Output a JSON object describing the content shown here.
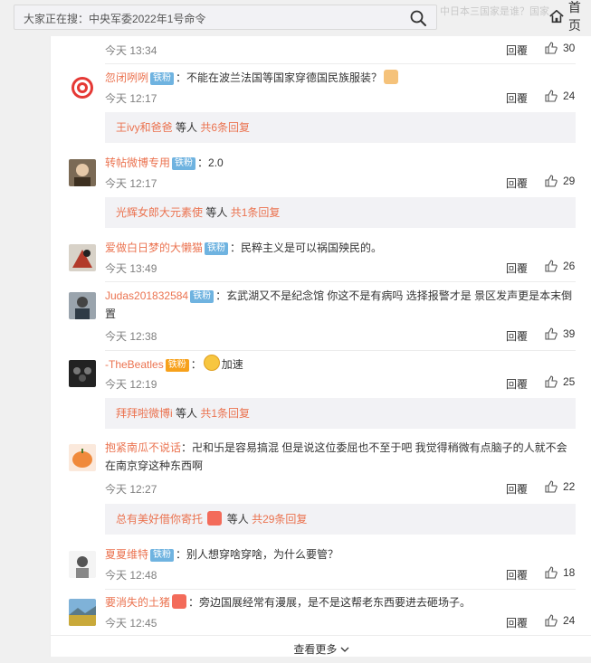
{
  "search": {
    "placeholder": "大家正在搜：中央军委2022年1号命令"
  },
  "home_label": "首页",
  "ghost_text": "中日本三国家是谁？国家",
  "colors": {
    "username": "#eb7350",
    "badge": "#6fb3e0",
    "subbar": "#f2f2f5"
  },
  "comments": [
    {
      "time": "今天 13:34",
      "reply": "回覆",
      "likes": "30"
    },
    {
      "user": "忽闭咧咧",
      "badge": "铁粉",
      "text": "：不能在波兰法国等国家穿德国民族服装？",
      "time": "今天 12:17",
      "reply": "回覆",
      "likes": "24",
      "sub": {
        "name": "王ivy和爸爸",
        "mid": "等人",
        "count": "共6条回复"
      }
    },
    {
      "user": "转帖微博专用",
      "badge": "铁粉",
      "text": "：2.0",
      "time": "今天 12:17",
      "reply": "回覆",
      "likes": "29",
      "sub": {
        "name": "光辉女郎大元素使",
        "mid": "等人",
        "count": "共1条回复"
      }
    },
    {
      "user": "爱做白日梦的大懒猫",
      "badge": "铁粉",
      "text": "：民粹主义是可以祸国殃民的。",
      "time": "今天 13:49",
      "reply": "回覆",
      "likes": "26"
    },
    {
      "user": "Judas201832584",
      "badge": "铁粉",
      "text": "：玄武湖又不是纪念馆 你这不是有病吗 选择报警才是 景区发声更是本末倒",
      "text2": "置",
      "time": "今天 12:38",
      "reply": "回覆",
      "likes": "39"
    },
    {
      "user": "-TheBeatles",
      "badge": "铁粉",
      "text": "加速",
      "time": "今天 12:19",
      "reply": "回覆",
      "likes": "25",
      "sub": {
        "name": "拜拜啦微博i",
        "mid": "等人",
        "count": "共1条回复"
      }
    },
    {
      "user": "抱紧南瓜不说话",
      "badge": "",
      "text": "：卍和卐是容易搞混 但是说这位委屈也不至于吧 我觉得稍微有点脑子的人就不会",
      "text2": "在南京穿这种东西啊",
      "time": "今天 12:27",
      "reply": "回覆",
      "likes": "22",
      "sub": {
        "name": "总有美好借你寄托",
        "mid": "等人",
        "count": "共29条回复"
      }
    },
    {
      "user": "夏夏维特",
      "badge": "铁粉",
      "text": "：别人想穿啥穿啥，为什么要管？",
      "time": "今天 12:48",
      "reply": "回覆",
      "likes": "18"
    },
    {
      "user": "要消失的土猪",
      "badge": "",
      "text": "：旁边国展经常有漫展，是不是这帮老东西要进去砸场子。",
      "time": "今天 12:45",
      "reply": "回覆",
      "likes": "24"
    }
  ],
  "more_label": "查看更多"
}
